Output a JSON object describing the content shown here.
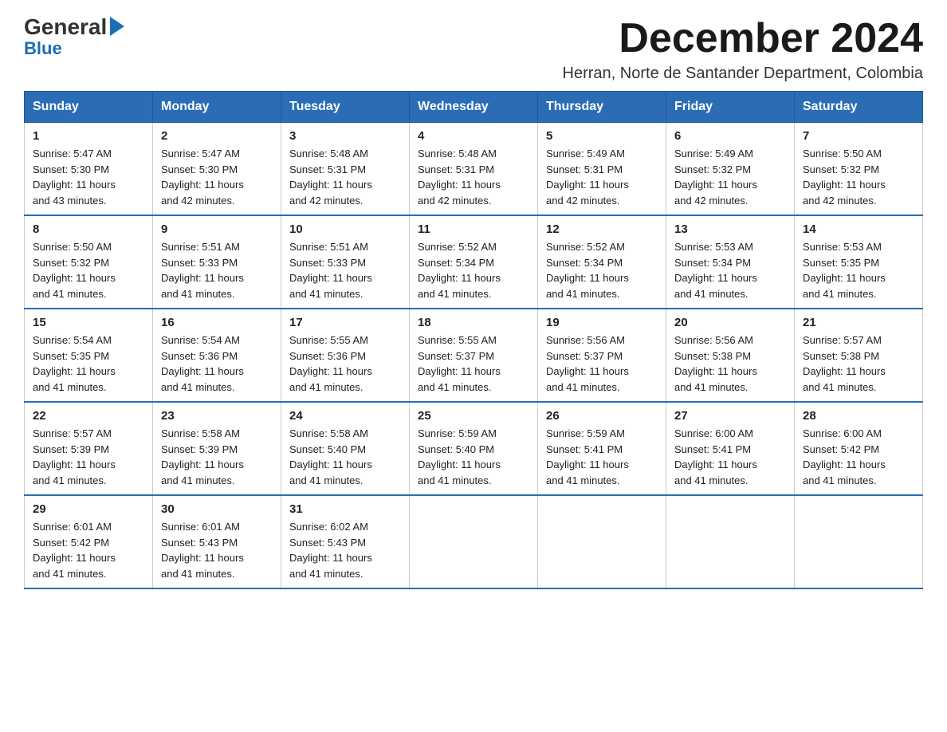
{
  "logo": {
    "general": "General",
    "blue": "Blue"
  },
  "header": {
    "month_title": "December 2024",
    "location": "Herran, Norte de Santander Department, Colombia"
  },
  "days_of_week": [
    "Sunday",
    "Monday",
    "Tuesday",
    "Wednesday",
    "Thursday",
    "Friday",
    "Saturday"
  ],
  "weeks": [
    [
      {
        "day": "1",
        "sunrise": "5:47 AM",
        "sunset": "5:30 PM",
        "daylight": "11 hours and 43 minutes."
      },
      {
        "day": "2",
        "sunrise": "5:47 AM",
        "sunset": "5:30 PM",
        "daylight": "11 hours and 42 minutes."
      },
      {
        "day": "3",
        "sunrise": "5:48 AM",
        "sunset": "5:31 PM",
        "daylight": "11 hours and 42 minutes."
      },
      {
        "day": "4",
        "sunrise": "5:48 AM",
        "sunset": "5:31 PM",
        "daylight": "11 hours and 42 minutes."
      },
      {
        "day": "5",
        "sunrise": "5:49 AM",
        "sunset": "5:31 PM",
        "daylight": "11 hours and 42 minutes."
      },
      {
        "day": "6",
        "sunrise": "5:49 AM",
        "sunset": "5:32 PM",
        "daylight": "11 hours and 42 minutes."
      },
      {
        "day": "7",
        "sunrise": "5:50 AM",
        "sunset": "5:32 PM",
        "daylight": "11 hours and 42 minutes."
      }
    ],
    [
      {
        "day": "8",
        "sunrise": "5:50 AM",
        "sunset": "5:32 PM",
        "daylight": "11 hours and 41 minutes."
      },
      {
        "day": "9",
        "sunrise": "5:51 AM",
        "sunset": "5:33 PM",
        "daylight": "11 hours and 41 minutes."
      },
      {
        "day": "10",
        "sunrise": "5:51 AM",
        "sunset": "5:33 PM",
        "daylight": "11 hours and 41 minutes."
      },
      {
        "day": "11",
        "sunrise": "5:52 AM",
        "sunset": "5:34 PM",
        "daylight": "11 hours and 41 minutes."
      },
      {
        "day": "12",
        "sunrise": "5:52 AM",
        "sunset": "5:34 PM",
        "daylight": "11 hours and 41 minutes."
      },
      {
        "day": "13",
        "sunrise": "5:53 AM",
        "sunset": "5:34 PM",
        "daylight": "11 hours and 41 minutes."
      },
      {
        "day": "14",
        "sunrise": "5:53 AM",
        "sunset": "5:35 PM",
        "daylight": "11 hours and 41 minutes."
      }
    ],
    [
      {
        "day": "15",
        "sunrise": "5:54 AM",
        "sunset": "5:35 PM",
        "daylight": "11 hours and 41 minutes."
      },
      {
        "day": "16",
        "sunrise": "5:54 AM",
        "sunset": "5:36 PM",
        "daylight": "11 hours and 41 minutes."
      },
      {
        "day": "17",
        "sunrise": "5:55 AM",
        "sunset": "5:36 PM",
        "daylight": "11 hours and 41 minutes."
      },
      {
        "day": "18",
        "sunrise": "5:55 AM",
        "sunset": "5:37 PM",
        "daylight": "11 hours and 41 minutes."
      },
      {
        "day": "19",
        "sunrise": "5:56 AM",
        "sunset": "5:37 PM",
        "daylight": "11 hours and 41 minutes."
      },
      {
        "day": "20",
        "sunrise": "5:56 AM",
        "sunset": "5:38 PM",
        "daylight": "11 hours and 41 minutes."
      },
      {
        "day": "21",
        "sunrise": "5:57 AM",
        "sunset": "5:38 PM",
        "daylight": "11 hours and 41 minutes."
      }
    ],
    [
      {
        "day": "22",
        "sunrise": "5:57 AM",
        "sunset": "5:39 PM",
        "daylight": "11 hours and 41 minutes."
      },
      {
        "day": "23",
        "sunrise": "5:58 AM",
        "sunset": "5:39 PM",
        "daylight": "11 hours and 41 minutes."
      },
      {
        "day": "24",
        "sunrise": "5:58 AM",
        "sunset": "5:40 PM",
        "daylight": "11 hours and 41 minutes."
      },
      {
        "day": "25",
        "sunrise": "5:59 AM",
        "sunset": "5:40 PM",
        "daylight": "11 hours and 41 minutes."
      },
      {
        "day": "26",
        "sunrise": "5:59 AM",
        "sunset": "5:41 PM",
        "daylight": "11 hours and 41 minutes."
      },
      {
        "day": "27",
        "sunrise": "6:00 AM",
        "sunset": "5:41 PM",
        "daylight": "11 hours and 41 minutes."
      },
      {
        "day": "28",
        "sunrise": "6:00 AM",
        "sunset": "5:42 PM",
        "daylight": "11 hours and 41 minutes."
      }
    ],
    [
      {
        "day": "29",
        "sunrise": "6:01 AM",
        "sunset": "5:42 PM",
        "daylight": "11 hours and 41 minutes."
      },
      {
        "day": "30",
        "sunrise": "6:01 AM",
        "sunset": "5:43 PM",
        "daylight": "11 hours and 41 minutes."
      },
      {
        "day": "31",
        "sunrise": "6:02 AM",
        "sunset": "5:43 PM",
        "daylight": "11 hours and 41 minutes."
      },
      null,
      null,
      null,
      null
    ]
  ],
  "labels": {
    "sunrise": "Sunrise:",
    "sunset": "Sunset:",
    "daylight": "Daylight:"
  }
}
